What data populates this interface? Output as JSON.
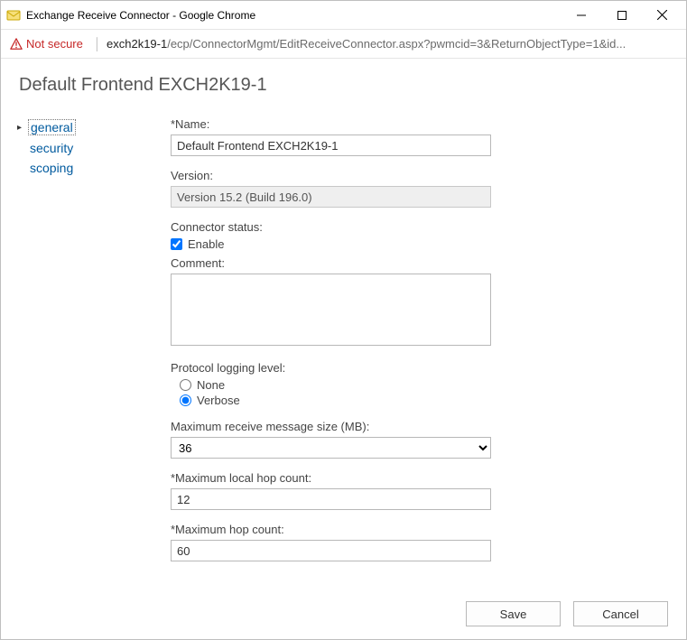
{
  "window": {
    "title": "Exchange Receive Connector - Google Chrome"
  },
  "addressbar": {
    "not_secure": "Not secure",
    "host": "exch2k19-1",
    "path": "/ecp/ConnectorMgmt/EditReceiveConnector.aspx?pwmcid=3&ReturnObjectType=1&id..."
  },
  "page": {
    "title": "Default Frontend EXCH2K19-1"
  },
  "nav": {
    "items": [
      "general",
      "security",
      "scoping"
    ],
    "active_index": 0
  },
  "form": {
    "name_label": "*Name:",
    "name_value": "Default Frontend EXCH2K19-1",
    "version_label": "Version:",
    "version_value": "Version 15.2 (Build 196.0)",
    "status_label": "Connector status:",
    "enable_label": "Enable",
    "enable_checked": true,
    "comment_label": "Comment:",
    "comment_value": "",
    "logging_label": "Protocol logging level:",
    "logging_options": {
      "none": "None",
      "verbose": "Verbose"
    },
    "logging_selected": "verbose",
    "max_recv_label": "Maximum receive message size (MB):",
    "max_recv_value": "36",
    "max_local_hop_label": "*Maximum local hop count:",
    "max_local_hop_value": "12",
    "max_hop_label": "*Maximum hop count:",
    "max_hop_value": "60"
  },
  "buttons": {
    "save": "Save",
    "cancel": "Cancel"
  }
}
